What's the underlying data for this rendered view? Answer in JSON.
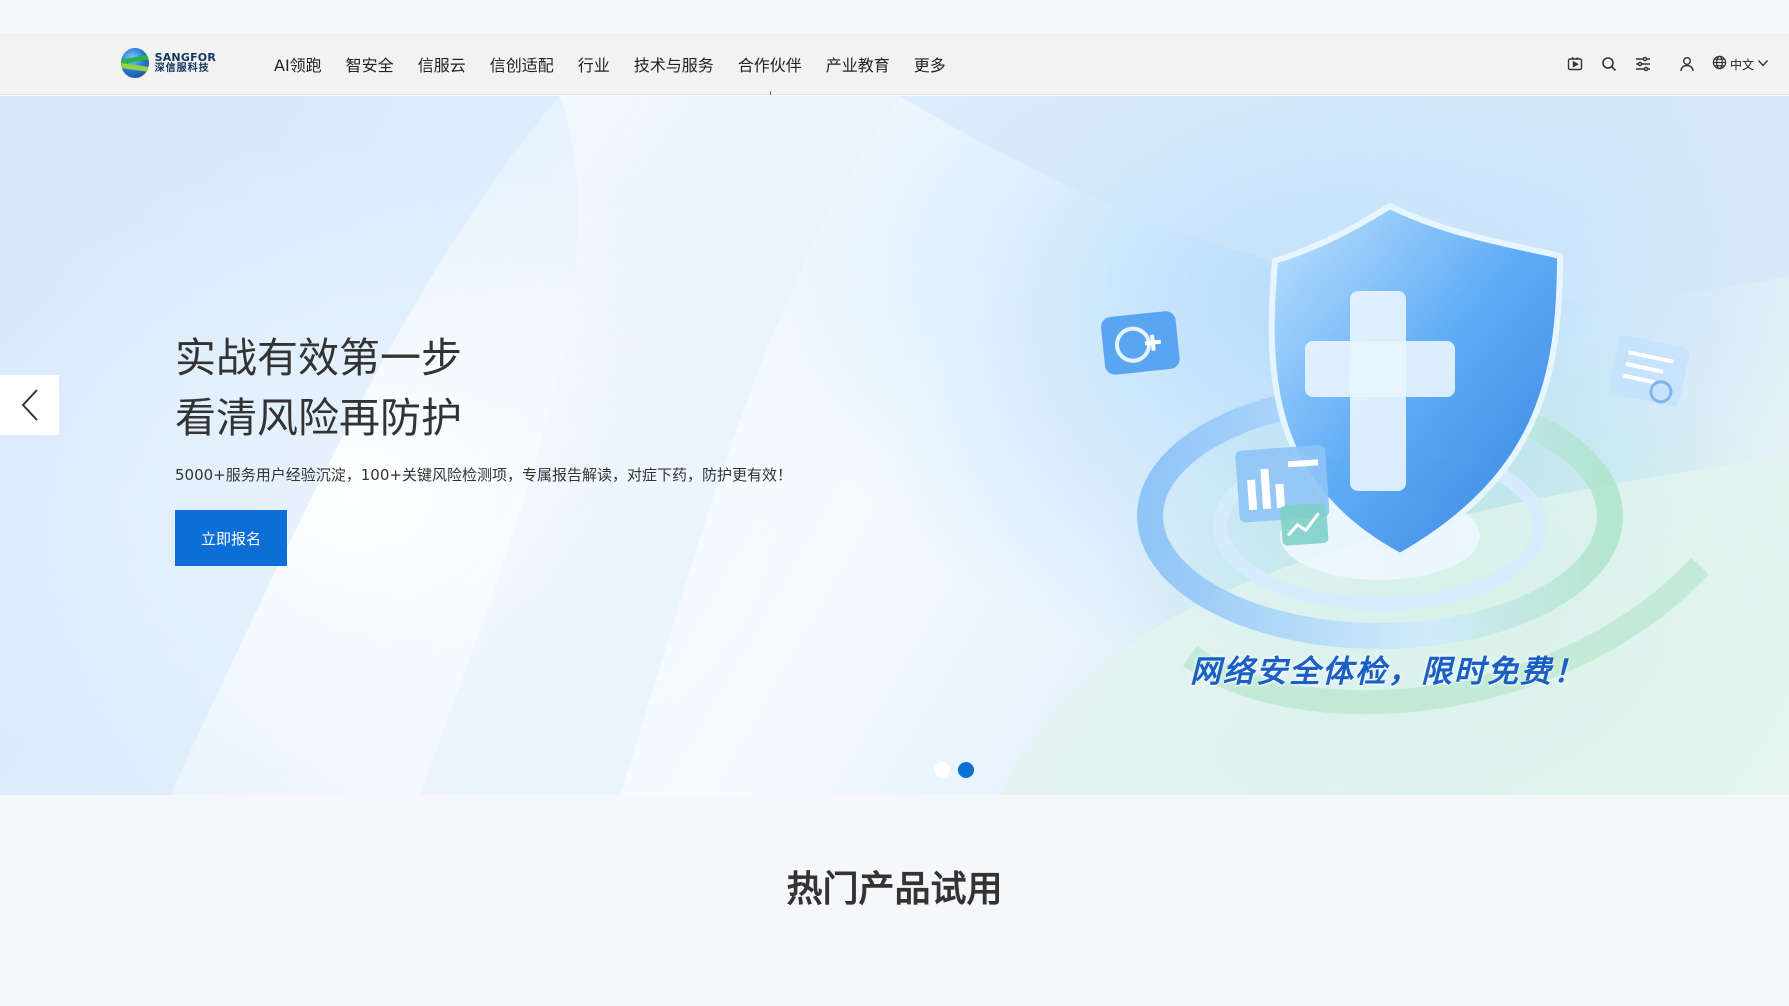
{
  "brand": {
    "name_en": "SANGFOR",
    "name_cn": "深信服科技"
  },
  "nav": {
    "items": [
      {
        "label": "AI领跑"
      },
      {
        "label": "智安全"
      },
      {
        "label": "信服云"
      },
      {
        "label": "信创适配"
      },
      {
        "label": "行业"
      },
      {
        "label": "技术与服务"
      },
      {
        "label": "合作伙伴"
      },
      {
        "label": "产业教育"
      },
      {
        "label": "更多"
      }
    ],
    "tools": {
      "video_icon": "video-icon",
      "search_icon": "search-icon",
      "menu_icon": "filter-icon",
      "user_icon": "user-icon",
      "language": "中文"
    }
  },
  "hero": {
    "title_line1": "实战有效第一步",
    "title_line2": "看清风险再防护",
    "subtitle": "5000+服务用户经验沉淀，100+关键风险检测项，专属报告解读，对症下药，防护更有效！",
    "cta": "立即报名",
    "promo": "网络安全体检，限时免费！",
    "slides_total": 2,
    "active_slide": 2
  },
  "section": {
    "title": "热门产品试用"
  },
  "colors": {
    "accent": "#0c6ed7",
    "nav_bg": "#f2f2f3",
    "page_bg": "#f6f7fa"
  }
}
